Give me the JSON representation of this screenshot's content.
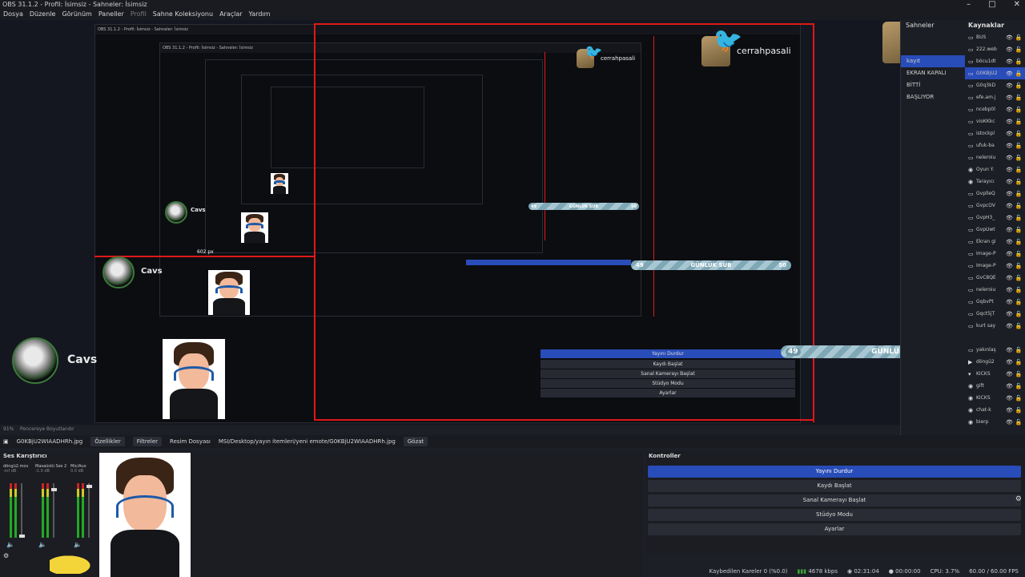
{
  "window": {
    "title": "OBS 31.1.2 - Profil: İsimsiz - Sahneler: İsimsiz",
    "minimize": "–",
    "maximize": "□",
    "close": "✕"
  },
  "menu": [
    "Dosya",
    "Düzenle",
    "Görünüm",
    "Paneller",
    "Profil",
    "Sahne Koleksiyonu",
    "Araçlar",
    "Yardım"
  ],
  "preview": {
    "overlay_label": "GÜNLÜK SUB",
    "overlay_left": "49",
    "overlay_right": "50",
    "overlay_left_small": "49",
    "overlay_right_small": "50",
    "cavs": "Cavs",
    "handle": "cerrahpasali",
    "size_label": "602 px",
    "nested_window_title": "OBS 31.1.2 - Profil: İsimsiz - Sahneler: İsimsiz"
  },
  "scenes": {
    "header": "Sahneler",
    "items": [
      "kayıt",
      "EKRAN KAPALI",
      "BİTTİ",
      "BAŞLIYOR"
    ],
    "selected_index": 0
  },
  "sources": {
    "header": "Kaynaklar",
    "items": [
      {
        "name": "BUS",
        "icon": "▭"
      },
      {
        "name": "222.web",
        "icon": "▭"
      },
      {
        "name": "böcu1dt",
        "icon": "▭"
      },
      {
        "name": "G0KBjU2",
        "icon": "▭"
      },
      {
        "name": "G0q3kD",
        "icon": "▭"
      },
      {
        "name": "efe.am.j",
        "icon": "▭"
      },
      {
        "name": "ncebp0l",
        "icon": "▭"
      },
      {
        "name": "vioKKkc",
        "icon": "▭"
      },
      {
        "name": "istockpl",
        "icon": "▭"
      },
      {
        "name": "ufuk-ba",
        "icon": "▭"
      },
      {
        "name": "neleroiu",
        "icon": "▭"
      },
      {
        "name": "Oyun Y.",
        "icon": "◉"
      },
      {
        "name": "Tarayıcı",
        "icon": "◉"
      },
      {
        "name": "GvplleQ",
        "icon": "▭"
      },
      {
        "name": "GvpcOV",
        "icon": "▭"
      },
      {
        "name": "GvpH3_",
        "icon": "▭"
      },
      {
        "name": "GvpUwt",
        "icon": "▭"
      },
      {
        "name": "Ekran gi",
        "icon": "▭"
      },
      {
        "name": "Image-P",
        "icon": "▭"
      },
      {
        "name": "Image-P",
        "icon": "▭"
      },
      {
        "name": "GvC8QE",
        "icon": "▭"
      },
      {
        "name": "neleroiu",
        "icon": "▭"
      },
      {
        "name": "GqbvPt",
        "icon": "▭"
      },
      {
        "name": "Gqct5jT",
        "icon": "▭"
      },
      {
        "name": "kurt say",
        "icon": "▭"
      },
      {
        "name": "",
        "icon": ""
      },
      {
        "name": "yakınlaş",
        "icon": "▭"
      },
      {
        "name": "döngü2",
        "icon": "▶"
      },
      {
        "name": "KICKS",
        "icon": "▾"
      },
      {
        "name": "gift",
        "icon": "◉"
      },
      {
        "name": "KICKS",
        "icon": "◉"
      },
      {
        "name": "chat-k",
        "icon": "◉"
      },
      {
        "name": "bierp",
        "icon": "◉"
      }
    ],
    "selected_index": 3
  },
  "zoom": {
    "percent": "91%",
    "fit_label": "Pencereye Boyutlandır"
  },
  "props": {
    "source_name": "G0KBjU2WIAADHRh.jpg",
    "properties": "Özellikler",
    "filters": "Filtreler",
    "image_file_label": "Resim Dosyası",
    "image_path": "MSI/Desktop/yayın itemleri/yeni emote/G0KBjU2WIAADHRh.jpg",
    "browse": "Gözat"
  },
  "mixer": {
    "header": "Ses Karıştırıcı",
    "channels": [
      {
        "name": "döngü2.mov",
        "db": "-inf dB"
      },
      {
        "name": "Masaüstü Ses 2",
        "db": "-1.0 dB"
      },
      {
        "name": "Mic/Aux",
        "db": "0.0 dB"
      }
    ]
  },
  "controls": {
    "header": "Kontroller",
    "buttons": [
      "Yayını Durdur",
      "Kaydı Başlat",
      "Sanal Kamerayı Başlat",
      "Stüdyo Modu",
      "Ayarlar"
    ]
  },
  "status": {
    "dropped_frames": "Kaybedilen Kareler 0 (%0.0)",
    "bitrate": "4678 kbps",
    "stream_time": "02:31:04",
    "record_time": "00:00:00",
    "cpu": "CPU: 3.7%",
    "fps": "60.00 / 60.00 FPS"
  },
  "colors": {
    "accent": "#284cb8",
    "red_guides": "#e01818",
    "twitter": "#37a6f2"
  }
}
